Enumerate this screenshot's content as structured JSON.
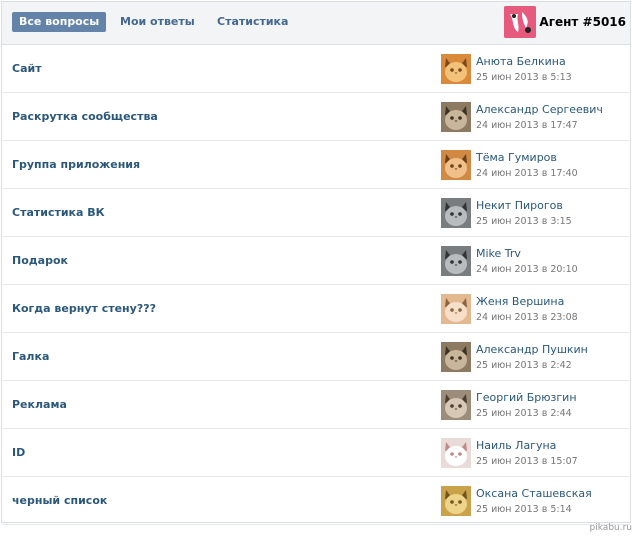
{
  "tabs": [
    {
      "label": "Все вопросы",
      "active": true
    },
    {
      "label": "Мои ответы",
      "active": false
    },
    {
      "label": "Статистика",
      "active": false
    }
  ],
  "agent": {
    "name": "Агент #5016",
    "logo_color": "#e65a7d"
  },
  "questions": [
    {
      "title": "Сайт",
      "author": "Анюта Белкина",
      "date": "25 июн 2013 в 5:13",
      "avatar": "orange-kitten-icon"
    },
    {
      "title": "Раскрутка сообщества",
      "author": "Александр Сергеевич",
      "date": "24 июн 2013 в 17:47",
      "avatar": "tabby-cat-icon"
    },
    {
      "title": "Группа приложения",
      "author": "Тёма Гумиров",
      "date": "24 июн 2013 в 17:40",
      "avatar": "ginger-kitten-icon"
    },
    {
      "title": "Статистика ВК",
      "author": "Некит Пирогов",
      "date": "25 июн 2013 в 3:15",
      "avatar": "grey-cat-icon"
    },
    {
      "title": "Подарок",
      "author": "Mike Trv",
      "date": "24 июн 2013 в 20:10",
      "avatar": "grey-cat-icon"
    },
    {
      "title": "Когда вернут стену???",
      "author": "Женя Вершина",
      "date": "24 июн 2013 в 23:08",
      "avatar": "kitten-icon"
    },
    {
      "title": "Галка",
      "author": "Александр Пушкин",
      "date": "25 июн 2013 в 2:42",
      "avatar": "tabby-cat-icon"
    },
    {
      "title": "Реклама",
      "author": "Георгий Брюзгин",
      "date": "25 июн 2013 в 2:44",
      "avatar": "cat-face-icon"
    },
    {
      "title": "ID",
      "author": "Наиль Лагуна",
      "date": "25 июн 2013 в 15:07",
      "avatar": "white-kitten-icon"
    },
    {
      "title": "черный список",
      "author": "Оксана Сташевская",
      "date": "25 июн 2013 в 5:14",
      "avatar": "yellow-kitten-icon"
    }
  ],
  "watermark": "pikabu.ru"
}
